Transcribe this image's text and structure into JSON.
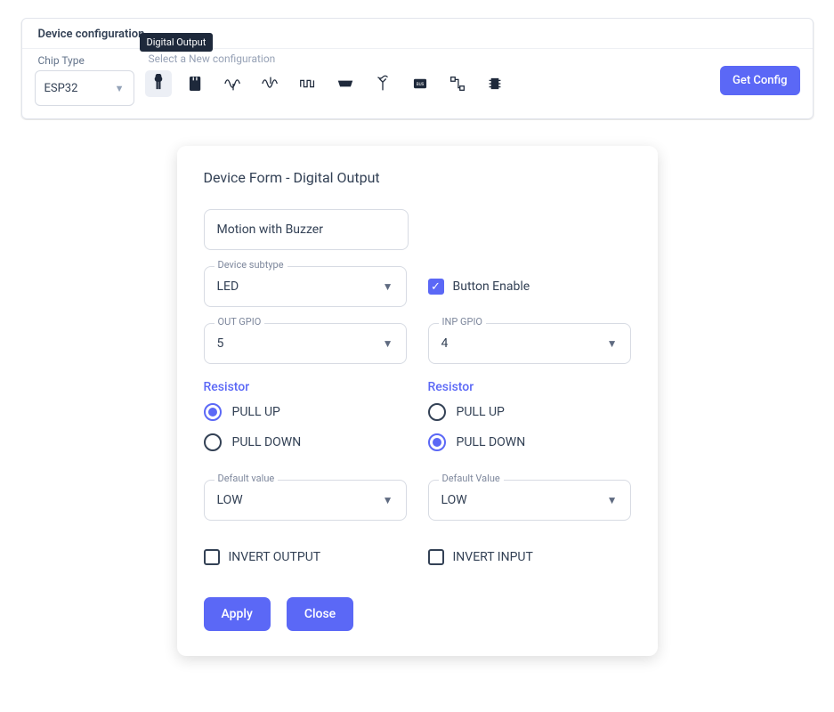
{
  "topCard": {
    "title": "Device configuration",
    "chip": {
      "label": "Chip Type",
      "value": "ESP32"
    },
    "selectLabel": "Select a New configuration",
    "tooltip": "Digital Output",
    "getConfig": "Get Config"
  },
  "modal": {
    "title": "Device Form - Digital Output",
    "name": "Motion with Buzzer",
    "subtype": {
      "label": "Device subtype",
      "value": "LED"
    },
    "buttonEnable": {
      "label": "Button Enable",
      "checked": true
    },
    "outGpio": {
      "label": "OUT GPIO",
      "value": "5"
    },
    "inpGpio": {
      "label": "INP GPIO",
      "value": "4"
    },
    "resistorLeft": {
      "label": "Resistor",
      "pullUp": "PULL UP",
      "pullDown": "PULL DOWN",
      "selected": "up"
    },
    "resistorRight": {
      "label": "Resistor",
      "pullUp": "PULL UP",
      "pullDown": "PULL DOWN",
      "selected": "down"
    },
    "defaultLeft": {
      "label": "Default value",
      "value": "LOW"
    },
    "defaultRight": {
      "label": "Default Value",
      "value": "LOW"
    },
    "invertOutput": {
      "label": "INVERT OUTPUT",
      "checked": false
    },
    "invertInput": {
      "label": "INVERT INPUT",
      "checked": false
    },
    "apply": "Apply",
    "close": "Close"
  }
}
